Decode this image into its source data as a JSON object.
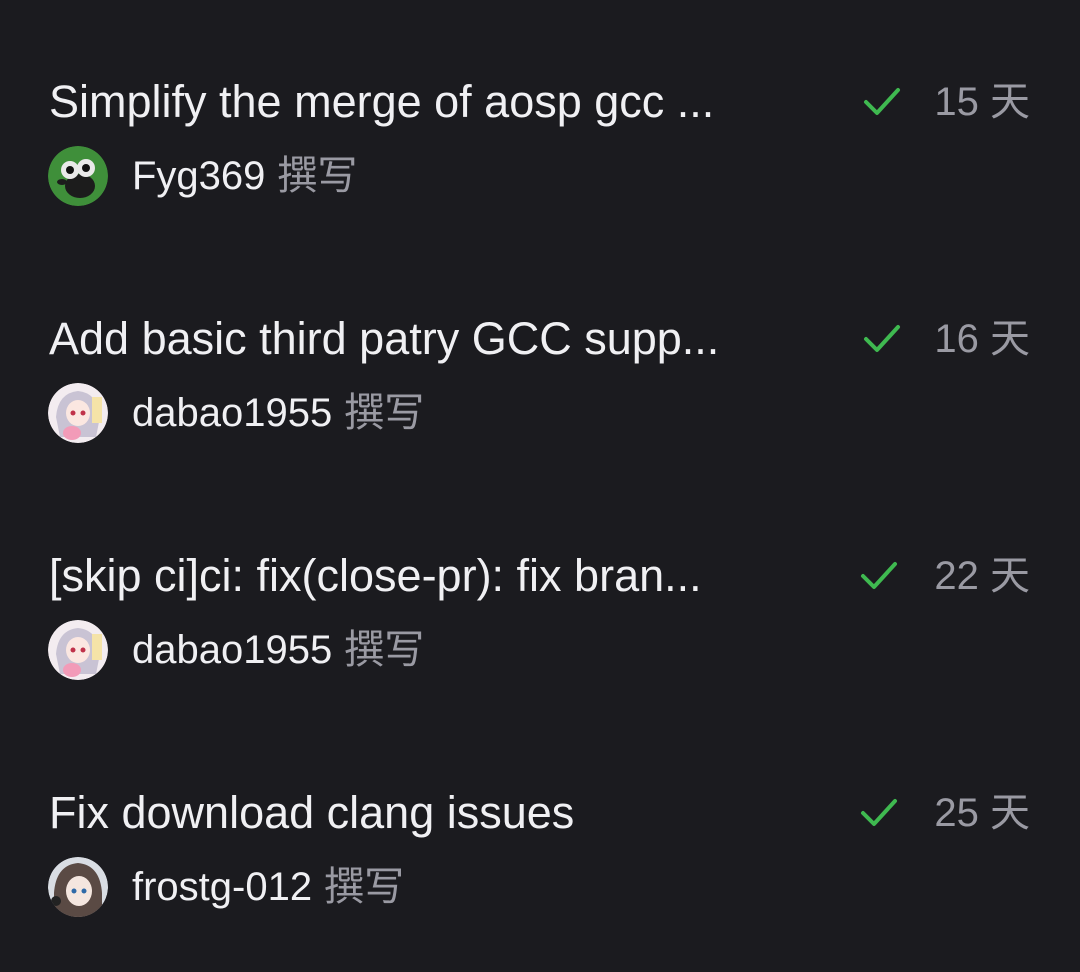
{
  "commits": [
    {
      "title": "Simplify the merge of aosp gcc ...",
      "author": "Fyg369",
      "verb": "撰写",
      "age": "15 天",
      "status": "success",
      "avatar": "green-cartoon-avatar"
    },
    {
      "title": "Add basic third patry GCC supp...",
      "author": "dabao1955",
      "verb": "撰写",
      "age": "16 天",
      "status": "success",
      "avatar": "anime-girl-avatar"
    },
    {
      "title": "[skip ci]ci: fix(close-pr): fix bran...",
      "author": "dabao1955",
      "verb": "撰写",
      "age": "22 天",
      "status": "success",
      "avatar": "anime-girl-avatar"
    },
    {
      "title": "Fix download clang issues",
      "author": "frostg-012",
      "verb": "撰写",
      "age": "25 天",
      "status": "success",
      "avatar": "anime-character-avatar"
    }
  ],
  "colors": {
    "background": "#1b1b1f",
    "text": "#f0f0f3",
    "muted": "#9a9aa3",
    "success": "#3fb950"
  }
}
